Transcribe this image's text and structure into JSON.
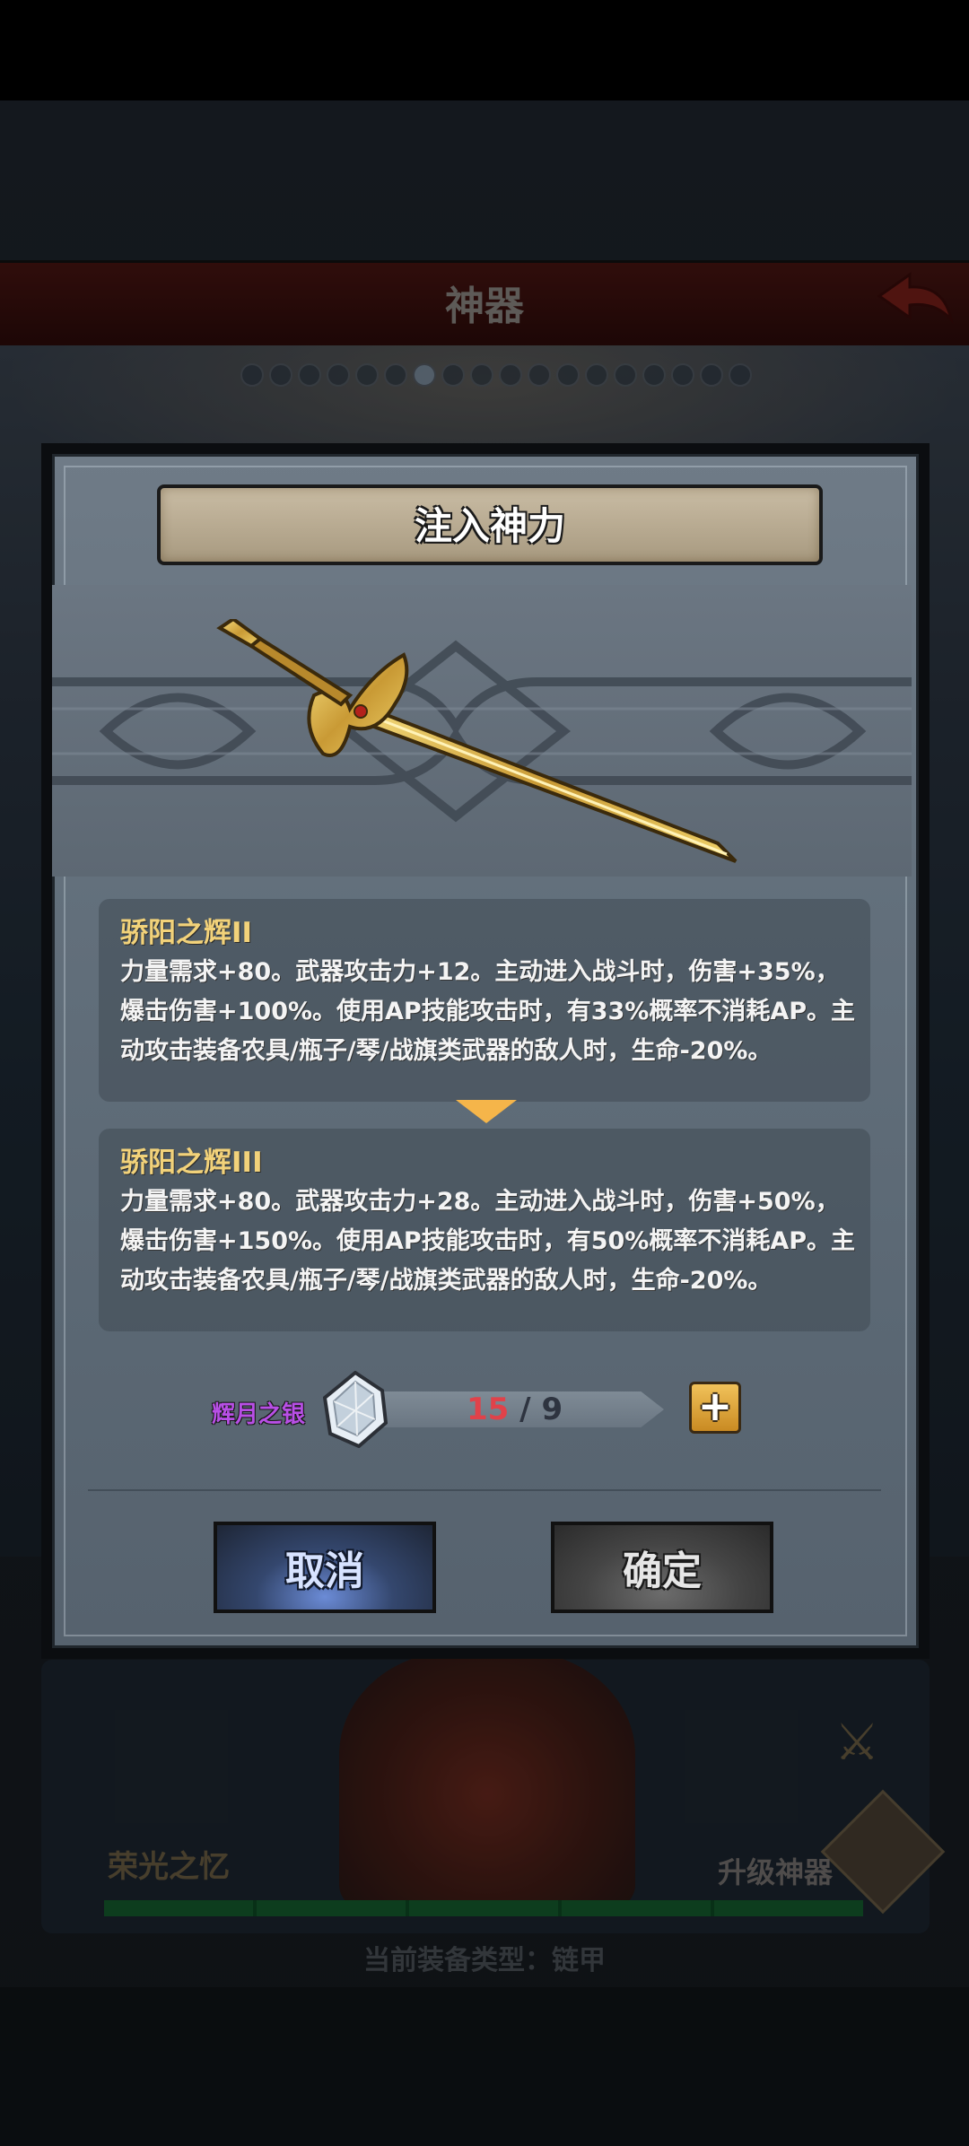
{
  "background": {
    "header_title": "神器",
    "glory_label": "荣光之忆",
    "upgrade_label": "升级神器",
    "equip_type_text": "当前装备类型：链甲",
    "pager": {
      "total": 18,
      "active_index": 6
    }
  },
  "dialog": {
    "title": "注入神力",
    "current": {
      "name": "骄阳之辉II",
      "lines": [
        "力量需求+80。武器攻击力+12。主动进入战斗时，伤害+35%，",
        "爆击伤害+100%。使用AP技能攻击时，有33%概率不消耗AP。主",
        "动攻击装备农具/瓶子/琴/战旗类武器的敌人时，生命-20%。"
      ]
    },
    "next": {
      "name": "骄阳之辉III",
      "lines": [
        "力量需求+80。武器攻击力+28。主动进入战斗时，伤害+50%，",
        "爆击伤害+150%。使用AP技能攻击时，有50%概率不消耗AP。主",
        "动攻击装备农具/瓶子/琴/战旗类武器的敌人时，生命-20%。"
      ]
    },
    "material": {
      "name": "辉月之银",
      "have": "15",
      "separator": "/",
      "need": "9",
      "add_icon": "plus-icon"
    },
    "cancel_label": "取消",
    "confirm_label": "确定"
  },
  "colors": {
    "accent_gold": "#f2d27a",
    "material_purple": "#b84fe6",
    "insufficient_red": "#e0424a",
    "cancel_blue": "#34476e"
  }
}
